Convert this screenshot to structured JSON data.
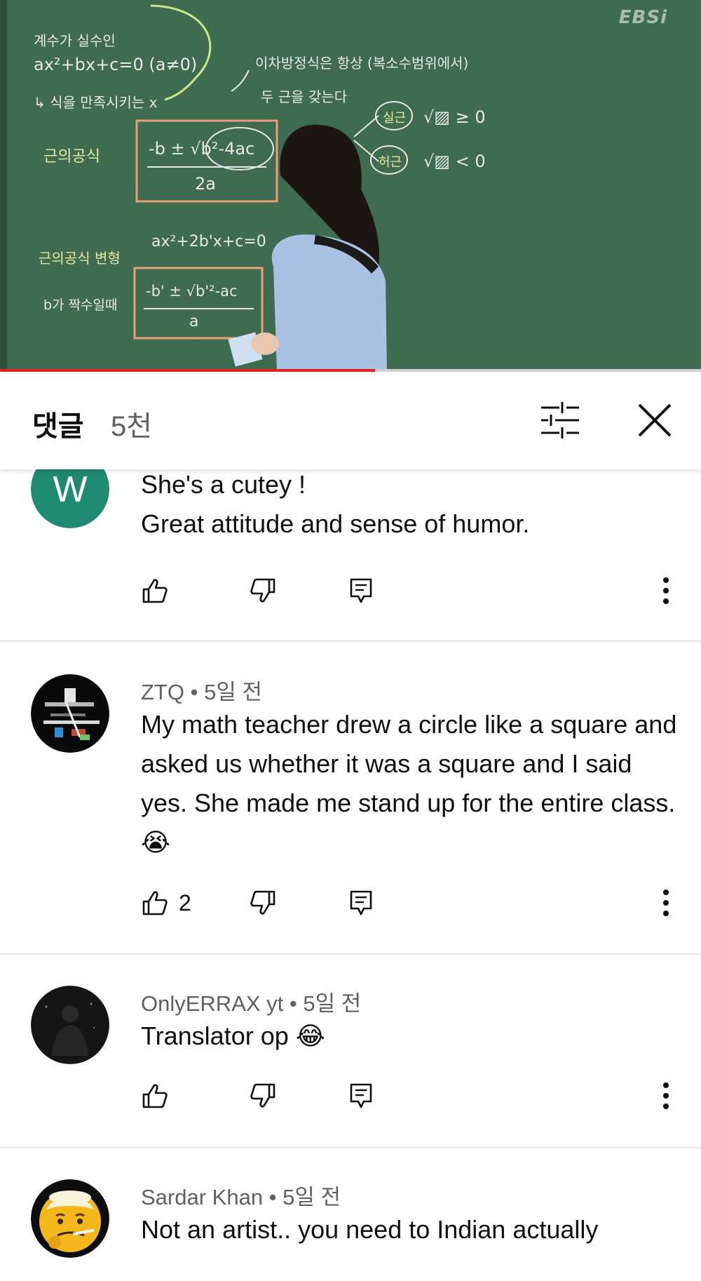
{
  "video": {
    "logo": "EBSi",
    "progress_fraction": 0.535,
    "board_text": {
      "eq1_label": "계수가 실수인",
      "eq1": "ax²+bx+c=0 (a≠0)",
      "satisfy": "↳ 식을 만족시키는 x",
      "formula_label": "근의공식",
      "formula_num": "-b ± √b²-4ac",
      "formula_den": "2a",
      "note1": "이차방정식은 항상 (복소수범위에서)",
      "note2": "두 근을 갖는다",
      "real_root": "실근",
      "imag_root": "허근",
      "real_cond": "√▨ ≥ 0",
      "imag_cond": "√▨ < 0",
      "even_label": "근의공식 변형",
      "even_cond": "b가 짝수일때",
      "eq2": "ax²+2b'x+c=0",
      "formula2_num": "-b' ± √b'²-ac",
      "formula2_den": "a"
    }
  },
  "header": {
    "title": "댓글",
    "count": "5천"
  },
  "icons": {
    "filter": "sliders-icon",
    "close": "close-icon",
    "like": "thumbs-up-icon",
    "dislike": "thumbs-down-icon",
    "reply": "reply-icon",
    "more": "more-vertical-icon"
  },
  "comments": [
    {
      "avatar_letter": "W",
      "avatar_color": "#1e8a72",
      "author": "",
      "time": "",
      "text": "She's a cutey !\nGreat attitude and sense of humor.",
      "likes": ""
    },
    {
      "author": "ZTQ",
      "time": "5일 전",
      "text": "My math teacher drew a circle like a square and asked us whether it was a square and I said yes. She made me stand up for the entire class.😭",
      "likes": "2"
    },
    {
      "author": "OnlyERRAX yt",
      "time": "5일 전",
      "text": "Translator op 😂",
      "likes": ""
    },
    {
      "author": "Sardar Khan",
      "time": "5일 전",
      "text": "Not an artist.. you need to Indian actually",
      "likes": ""
    }
  ],
  "separator": " • "
}
